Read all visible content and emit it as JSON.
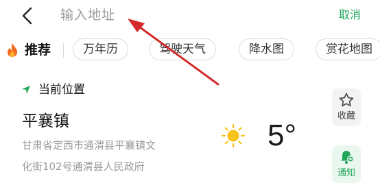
{
  "header": {
    "search_placeholder": "输入地址",
    "cancel_label": "取消"
  },
  "recommend": {
    "label": "推荐",
    "chips": [
      "万年历",
      "驾驶天气",
      "降水图",
      "赏花地图"
    ]
  },
  "current_location": {
    "label": "当前位置",
    "town": "平襄镇",
    "address_line1": "甘肃省定西市通渭县平襄镇文",
    "address_line2": "化街102号通渭县人民政府",
    "temperature": "5°",
    "weather_icon": "sun-icon"
  },
  "actions": {
    "favorite_label": "收藏",
    "notify_label": "通知"
  },
  "colors": {
    "accent": "#22a559",
    "annotation_arrow": "#d42a2a"
  }
}
